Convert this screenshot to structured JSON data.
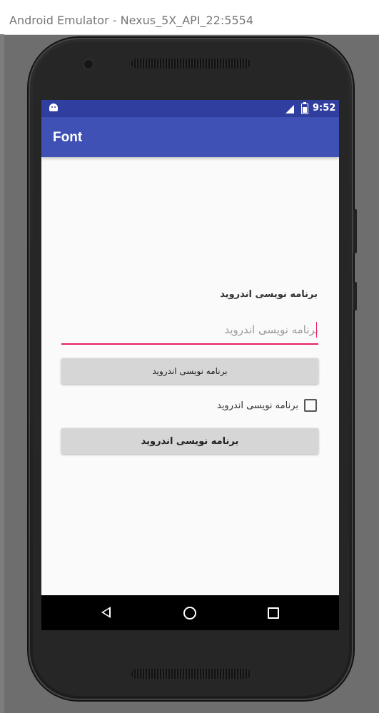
{
  "window": {
    "title": "Android Emulator - Nexus_5X_API_22:5554"
  },
  "statusbar": {
    "time": "9:52"
  },
  "appbar": {
    "title": "Font"
  },
  "form": {
    "label": "برنامه نویسی اندروید",
    "input_value": "برنامه نویسی اندروید",
    "button1_label": "برنامه نویسی اندروید",
    "checkbox_label": "برنامه نویسی اندروید",
    "checkbox_checked": false,
    "button2_label": "برنامه نویسی اندروید"
  },
  "colors": {
    "statusbar": "#303f9f",
    "appbar": "#3f51b5",
    "accent": "#e91e63",
    "button": "#d6d6d6"
  },
  "icons": {
    "status_left": "android-debug-icon",
    "signal": "signal-icon",
    "battery": "battery-icon",
    "nav_back": "back-icon",
    "nav_home": "home-icon",
    "nav_recent": "recent-apps-icon"
  }
}
